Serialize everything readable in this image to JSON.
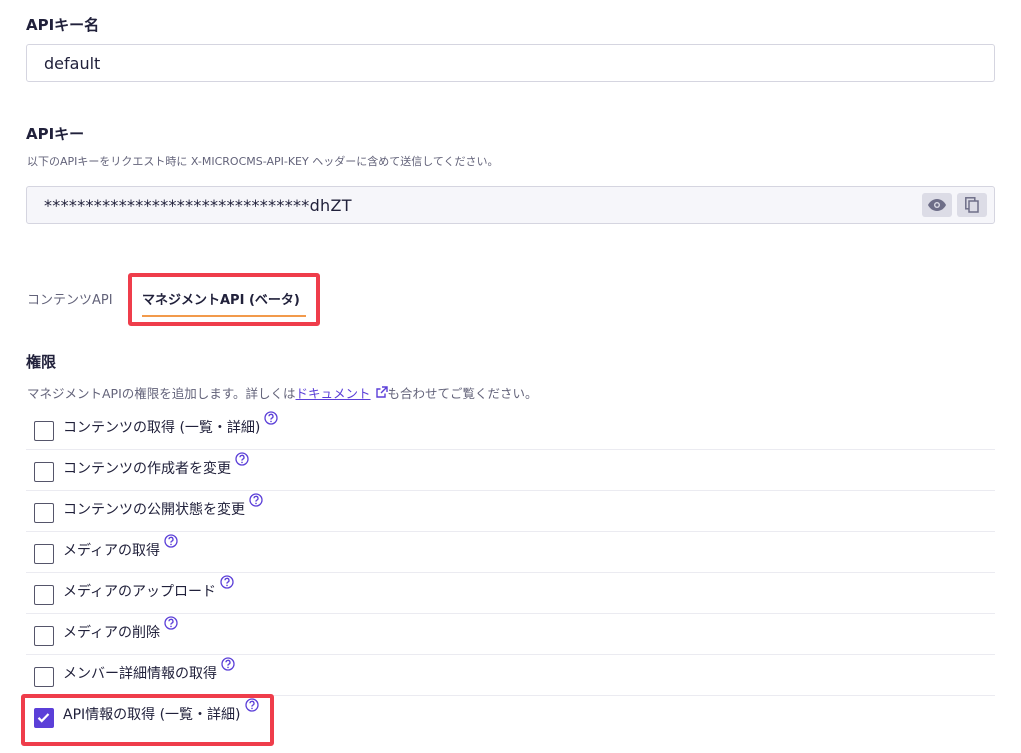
{
  "api_key_name": {
    "label": "APIキー名",
    "value": "default"
  },
  "api_key": {
    "label": "APIキー",
    "hint": "以下のAPIキーをリクエスト時に X-MICROCMS-API-KEY ヘッダーに含めて送信してください。",
    "masked_value": "********************************dhZT",
    "show_icon": "eye-icon",
    "copy_icon": "copy-icon"
  },
  "tabs": [
    {
      "label": "コンテンツAPI",
      "active": false
    },
    {
      "label": "マネジメントAPI (ベータ)",
      "active": true
    }
  ],
  "permissions": {
    "title": "権限",
    "description_prefix": "マネジメントAPIの権限を追加します。詳しくは",
    "doc_link": "ドキュメント",
    "description_suffix": "も合わせてご覧ください。",
    "items": [
      {
        "label": "コンテンツの取得 (一覧・詳細)",
        "checked": false
      },
      {
        "label": "コンテンツの作成者を変更",
        "checked": false
      },
      {
        "label": "コンテンツの公開状態を変更",
        "checked": false
      },
      {
        "label": "メディアの取得",
        "checked": false
      },
      {
        "label": "メディアのアップロード",
        "checked": false
      },
      {
        "label": "メディアの削除",
        "checked": false
      },
      {
        "label": "メンバー詳細情報の取得",
        "checked": false
      },
      {
        "label": "API情報の取得 (一覧・詳細)",
        "checked": true
      }
    ]
  },
  "colors": {
    "accent": "#5b3fd8",
    "highlight": "#ef3d4b",
    "tab_underline": "#f29a4b"
  }
}
